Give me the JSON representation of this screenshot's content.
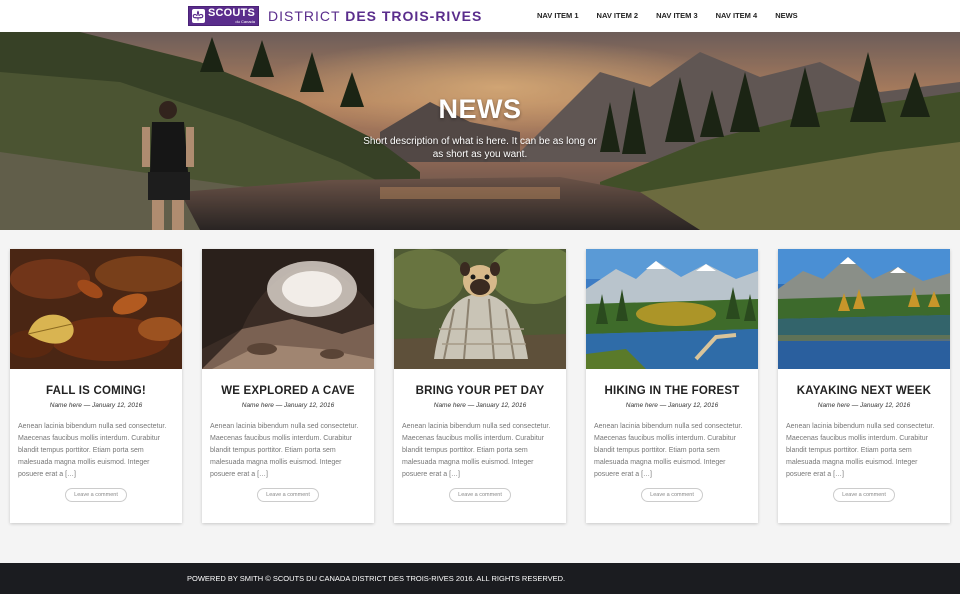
{
  "header": {
    "logo_word": "SCOUTS",
    "logo_sub": "du Canada",
    "district_light": "DISTRICT ",
    "district_bold": "DES TROIS-RIVES",
    "brand_color": "#5a2d8c",
    "nav": [
      "NAV ITEM 1",
      "NAV ITEM 2",
      "NAV ITEM 3",
      "NAV ITEM 4",
      "NEWS"
    ]
  },
  "hero": {
    "title": "NEWS",
    "description": "Short description of what is here. It can be as long or as short as you want."
  },
  "posts": [
    {
      "image": "autumn-leaves",
      "title": "FALL IS COMING!",
      "meta": "Name here — January 12, 2016",
      "excerpt": "Aenean lacinia bibendum nulla sed consectetur. Maecenas faucibus mollis interdum. Curabitur blandit tempus porttitor. Etiam porta sem malesuada magna mollis euismod. Integer posuere erat a […]",
      "button": "Leave a comment"
    },
    {
      "image": "cave",
      "title": "WE EXPLORED A CAVE",
      "meta": "Name here — January 12, 2016",
      "excerpt": "Aenean lacinia bibendum nulla sed consectetur. Maecenas faucibus mollis interdum. Curabitur blandit tempus porttitor. Etiam porta sem malesuada magna mollis euismod. Integer posuere erat a […]",
      "button": "Leave a comment"
    },
    {
      "image": "pug-in-blanket",
      "title": "BRING YOUR PET DAY",
      "meta": "Name here — January 12, 2016",
      "excerpt": "Aenean lacinia bibendum nulla sed consectetur. Maecenas faucibus mollis interdum. Curabitur blandit tempus porttitor. Etiam porta sem malesuada magna mollis euismod. Integer posuere erat a […]",
      "button": "Leave a comment"
    },
    {
      "image": "forest-lake",
      "title": "HIKING IN THE FOREST",
      "meta": "Name here — January 12, 2016",
      "excerpt": "Aenean lacinia bibendum nulla sed consectetur. Maecenas faucibus mollis interdum. Curabitur blandit tempus porttitor. Etiam porta sem malesuada magna mollis euismod. Integer posuere erat a […]",
      "button": "Leave a comment"
    },
    {
      "image": "mountain-lake",
      "title": "KAYAKING NEXT WEEK",
      "meta": "Name here — January 12, 2016",
      "excerpt": "Aenean lacinia bibendum nulla sed consectetur. Maecenas faucibus mollis interdum. Curabitur blandit tempus porttitor. Etiam porta sem malesuada magna mollis euismod. Integer posuere erat a […]",
      "button": "Leave a comment"
    }
  ],
  "footer": {
    "text": "POWERED BY SMITH © SCOUTS DU CANADA DISTRICT DES TROIS-RIVES 2016. ALL RIGHTS RESERVED."
  }
}
